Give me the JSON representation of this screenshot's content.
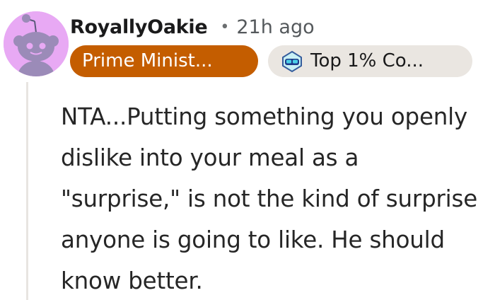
{
  "comment": {
    "username": "RoyallyOakie",
    "separator": "•",
    "timestamp": "21h ago",
    "flairs": {
      "primary": "Prime Minist...",
      "contributor": "Top 1% Co..."
    },
    "body": "NTA...Putting something you openly dislike into your meal as a \"surprise,\" is not the kind of surprise anyone is going to like. He should know better."
  },
  "icons": {
    "avatar": "reddit-snoo-avatar",
    "contributor_badge": "top-contributor-goggles-icon"
  },
  "colors": {
    "avatar_bg": "#e8a9f4",
    "primary_flair_bg": "#c45d00",
    "contributor_flair_bg": "#eae6e1",
    "thread_line": "#e8e5e1"
  }
}
